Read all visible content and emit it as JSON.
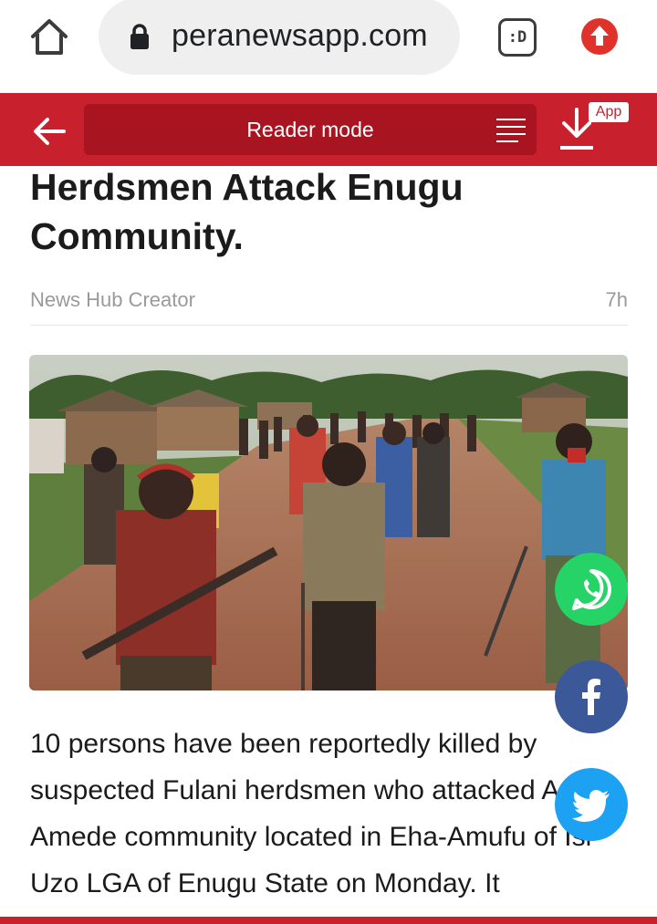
{
  "browser": {
    "url": "peranewsapp.com",
    "tab_switcher_label": ":D",
    "icons": [
      "home-icon",
      "lock-icon",
      "tab-switcher-icon",
      "update-arrow-icon"
    ]
  },
  "app_bar": {
    "reader_mode_label": "Reader mode",
    "app_badge": "App",
    "icons": [
      "back-arrow-icon",
      "menu-lines-icon",
      "download-icon"
    ],
    "accent_color": "#c8202c"
  },
  "article": {
    "title": "Herdsmen Attack Enugu Community.",
    "source": "News Hub Creator",
    "time": "7h",
    "image_icon": "article-photo",
    "body": "10 persons have been reportedly killed by suspected Fulani herdsmen who attacked Agu-Amede community located in Eha-Amufu of Isi-Uzo LGA of Enugu State on Monday. It"
  },
  "share": {
    "whatsapp_color": "#25d366",
    "facebook_color": "#3b5998",
    "twitter_color": "#1da1f2",
    "icons": [
      "whatsapp-icon",
      "facebook-icon",
      "twitter-icon"
    ]
  }
}
